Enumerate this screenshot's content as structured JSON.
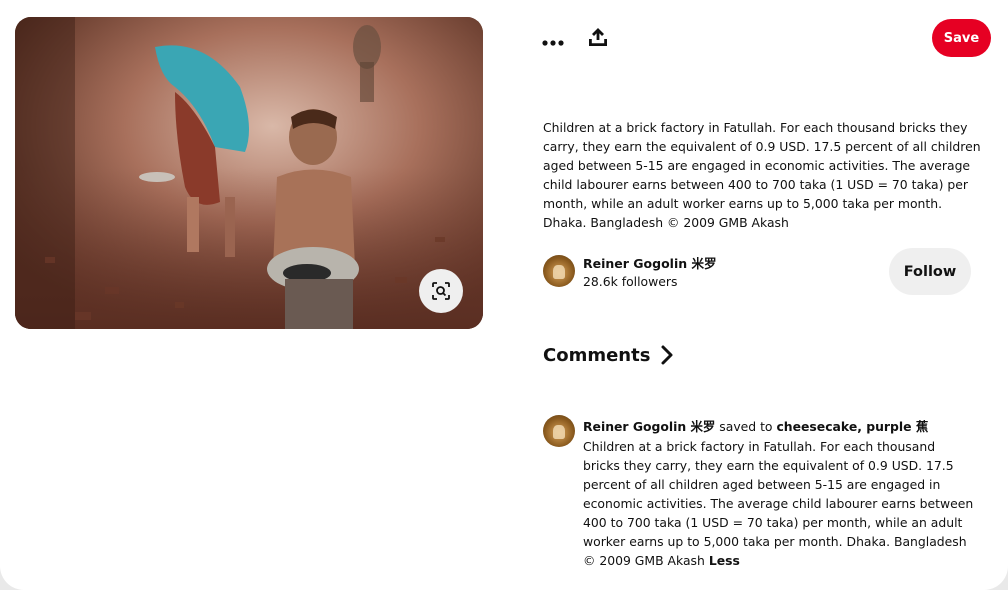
{
  "pin": {
    "image_alt": "Children at a brick factory in Fatullah",
    "description": "Children at a brick factory in Fatullah. For each thousand bricks they carry, they earn the equivalent of 0.9 USD. 17.5 percent of all children aged between 5-15 are engaged in economic activities. The average child labourer earns between 400 to 700 taka (1 USD = 70 taka) per month, while an adult worker earns up to 5,000 taka per month. Dhaka. Bangladesh © 2009 GMB Akash"
  },
  "toolbar": {
    "save_label": "Save",
    "more_icon": "more-horizontal-icon",
    "share_icon": "share-icon",
    "lens_icon": "visual-search-icon"
  },
  "author": {
    "name": "Reiner Gogolin 米罗",
    "followers": "28.6k followers",
    "follow_label": "Follow"
  },
  "comments": {
    "heading": "Comments",
    "activity": {
      "user": "Reiner Gogolin 米罗",
      "action": " saved to ",
      "board": "cheesecake, purple 蕉",
      "text": "Children at a brick factory in Fatullah. For each thousand bricks they carry, they earn the equivalent of 0.9 USD. 17.5 percent of all children aged between 5-15 are engaged in economic activities. The average child labourer earns between 400 to 700 taka (1 USD = 70 taka) per month, while an adult worker earns up to 5,000 taka per month. Dhaka. Bangladesh © 2009 GMB Akash",
      "less_label": "Less"
    }
  },
  "colors": {
    "save_button": "#e60023",
    "secondary_button": "#efefef"
  }
}
